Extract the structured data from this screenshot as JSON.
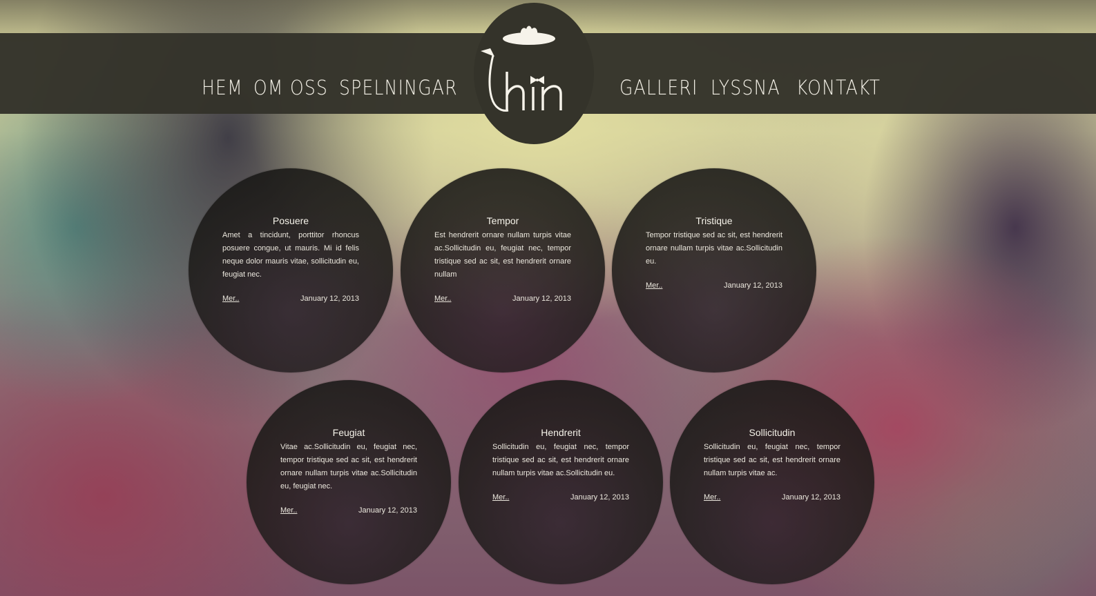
{
  "nav": {
    "left": [
      "HEM",
      "OM OSS",
      "SPELNINGAR"
    ],
    "right": [
      "GALLERI",
      "LYSSNA",
      "KONTAKT"
    ]
  },
  "logo": {
    "text": "hin",
    "icons": [
      "hat-icon",
      "bowtie-icon",
      "devil-tail-icon"
    ]
  },
  "posts": [
    {
      "title": "Posuere",
      "body": "Amet a tincidunt, porttitor rhoncus posuere congue, ut mauris. Mi id felis neque dolor mauris vitae, sollicitudin eu, feugiat nec.",
      "more": "Mer..",
      "date": "January 12, 2013"
    },
    {
      "title": "Tempor",
      "body": "Est hendrerit ornare nullam turpis vitae ac.Sollicitudin eu, feugiat nec, tempor tristique sed ac sit, est hendrerit ornare nullam",
      "more": "Mer..",
      "date": "January 12, 2013"
    },
    {
      "title": "Tristique",
      "body": "Tempor tristique sed ac sit, est hendrerit ornare nullam turpis vitae ac.Sollicitudin eu.",
      "more": "Mer..",
      "date": "January 12, 2013"
    },
    {
      "title": "Feugiat",
      "body": "Vitae ac.Sollicitudin eu, feugiat nec, tempor tristique sed ac sit, est hendrerit ornare nullam turpis vitae ac.Sollicitudin eu, feugiat nec.",
      "more": "Mer..",
      "date": "January 12, 2013"
    },
    {
      "title": "Hendrerit",
      "body": "Sollicitudin eu, feugiat nec, tempor tristique sed ac sit, est hendrerit ornare nullam turpis vitae ac.Sollicitudin eu.",
      "more": "Mer..",
      "date": "January 12, 2013"
    },
    {
      "title": "Sollicitudin",
      "body": "Sollicitudin eu, feugiat nec, tempor tristique sed ac sit, est hendrerit ornare nullam turpis vitae ac.",
      "more": "Mer..",
      "date": "January 12, 2013"
    }
  ],
  "colors": {
    "nav_bar": "#34332a",
    "bubble": "#1c1a18",
    "text": "#f3f0e6"
  }
}
